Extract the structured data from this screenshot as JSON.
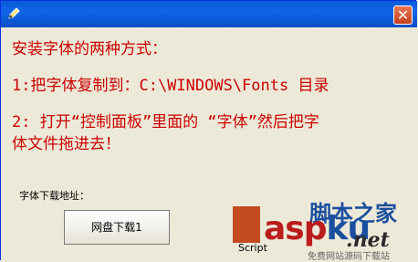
{
  "window": {
    "title": "",
    "close_label": "✕"
  },
  "content": {
    "line1": "安装字体的两种方式：",
    "line2": "1:把字体复制到：C:\\WINDOWS\\Fonts 目录",
    "line3": "2: 打开“控制面板”里面的 “字体”然后把字",
    "line4": "体文件拖进去！",
    "download_label": "字体下载地址：",
    "button_label": "网盘下载1"
  },
  "watermark": {
    "cn_text": "脚本之家",
    "asp_text": "asp",
    "ku_text": "ku",
    "script_text": "Script",
    "net_text": ".net",
    "tagline": "免费网站源码下载站"
  },
  "colors": {
    "title_bar": "#0a5bd9",
    "text_red": "#cc0000",
    "window_bg": "#ece9d8"
  }
}
